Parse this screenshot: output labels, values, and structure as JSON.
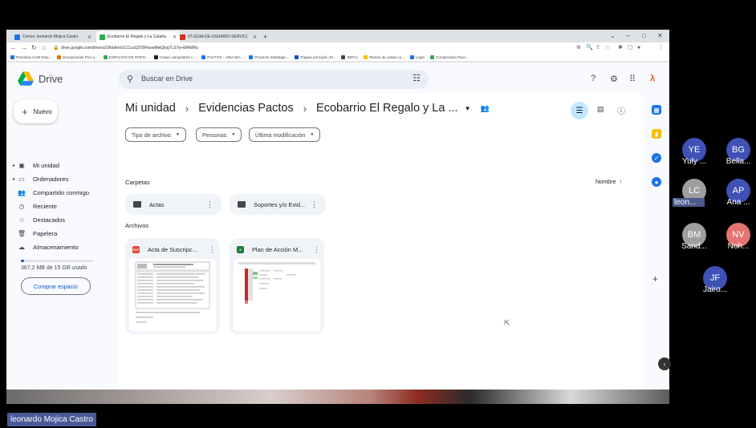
{
  "browser": {
    "tabs": [
      {
        "label": "Correo: leonardo Mojica Castro",
        "color": "#1a73e8",
        "active": false
      },
      {
        "label": "Ecobarrio El Regalo y La Cataña",
        "color": "#34a853",
        "active": true
      },
      {
        "label": "07-GUIA-DE-USUARIO-SERVICI",
        "color": "#d93025",
        "active": false
      }
    ],
    "new_tab": "+",
    "window_controls": [
      "⌄",
      "–",
      "□",
      "✕"
    ],
    "url": "drive.google.com/drive/u/1/folders/1CCuxQ2X9FkowMwQlsq7LS7w-kM4dWu",
    "bookmarks": [
      {
        "label": "Practicas CUN Estu...",
        "color": "#1a73e8"
      },
      {
        "label": "Excepciones Pico y...",
        "color": "#e37400"
      },
      {
        "label": "ESPACIOS DE PARTI...",
        "color": "#34a853"
      },
      {
        "label": "Casas campestres c...",
        "color": "#1f1f1f"
      },
      {
        "label": "PACTOS - VINA MA...",
        "color": "#1a73e8"
      },
      {
        "label": "Proyecto estrategic...",
        "color": "#1a73e8"
      },
      {
        "label": "Página principal | M...",
        "color": "#0b57d0"
      },
      {
        "label": "IDPAC",
        "color": "#444"
      },
      {
        "label": "Planos de casas ca...",
        "color": "#fbbc04"
      },
      {
        "label": "Login",
        "color": "#1a73e8"
      },
      {
        "label": "Compromiso Pact...",
        "color": "#34a853"
      }
    ]
  },
  "drive": {
    "title": "Drive",
    "search_placeholder": "Buscar en Drive",
    "new_button": "Nuevo",
    "nav": [
      {
        "label": "Mi unidad",
        "icon": "drive-icon",
        "glyph": "▣",
        "dot": true
      },
      {
        "label": "Ordenadores",
        "icon": "computer-icon",
        "glyph": "▭",
        "dot": true
      },
      {
        "label": "Compartido conmigo",
        "icon": "people-icon",
        "glyph": "👥",
        "dot": false
      },
      {
        "label": "Reciente",
        "icon": "clock-icon",
        "glyph": "◷",
        "dot": false
      },
      {
        "label": "Destacados",
        "icon": "star-icon",
        "glyph": "☆",
        "dot": false
      },
      {
        "label": "Papelera",
        "icon": "trash-icon",
        "glyph": "🗑",
        "dot": false
      },
      {
        "label": "Almacenamiento",
        "icon": "cloud-icon",
        "glyph": "☁",
        "dot": false
      }
    ],
    "storage_text": "367,2 MB de 15 GB usado",
    "storage_used_fraction": 0.024,
    "buy_storage": "Comprar espacio",
    "breadcrumb": [
      "Mi unidad",
      "Evidencias Pactos",
      "Ecobarrio El Regalo y La ..."
    ],
    "filters": [
      "Tipo de archivo",
      "Personas",
      "Última modificación"
    ],
    "section_folders": "Carpetas",
    "section_files": "Archivos",
    "sort_label": "Nombre",
    "folders": [
      {
        "name": "Actas"
      },
      {
        "name": "Soportes y/o Evid..."
      }
    ],
    "files": [
      {
        "name": "Acta de Suscripc...",
        "type": "PDF",
        "color": "#ea4335"
      },
      {
        "name": "Plan de Acción M...",
        "type": "X",
        "color": "#188038"
      }
    ]
  },
  "meeting": {
    "participants": [
      {
        "initials": "YE",
        "name": "Yuly ...",
        "color": "#3f51b5",
        "highlight": false
      },
      {
        "initials": "BG",
        "name": "Bella...",
        "color": "#3f51b5",
        "highlight": false
      },
      {
        "initials": "LC",
        "name": "leon...",
        "color": "#9e9e9e",
        "highlight": true
      },
      {
        "initials": "AP",
        "name": "Ana ...",
        "color": "#3f51b5",
        "highlight": false
      },
      {
        "initials": "BM",
        "name": "Sand...",
        "color": "#9e9e9e",
        "highlight": false
      },
      {
        "initials": "NV",
        "name": "Noh...",
        "color": "#e57373",
        "highlight": false
      },
      {
        "initials": "JF",
        "name": "Jairo...",
        "color": "#3f51b5",
        "highlight": false
      }
    ],
    "speaker_name": "leonardo Mojica Castro"
  }
}
